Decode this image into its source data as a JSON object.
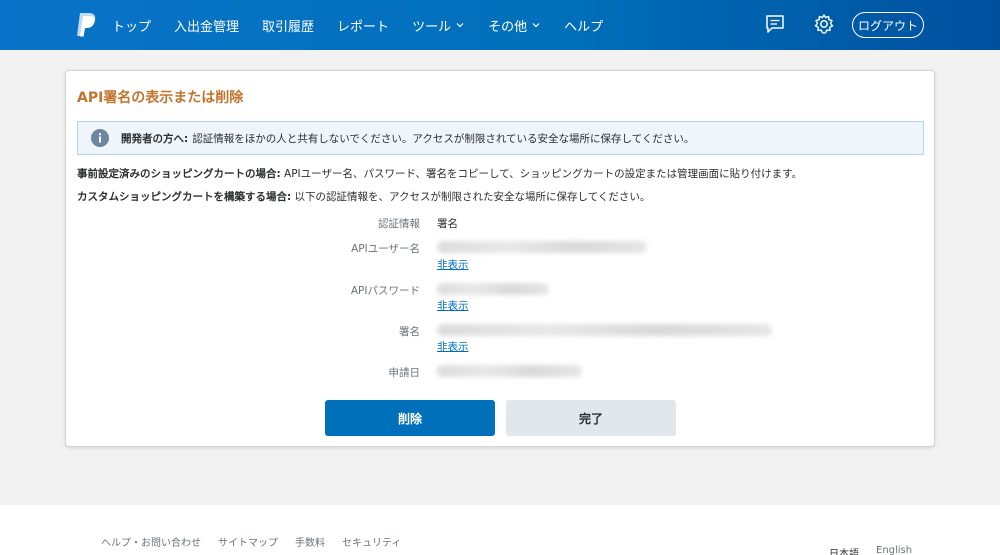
{
  "header": {
    "nav": [
      {
        "label": "トップ",
        "dropdown": false
      },
      {
        "label": "入出金管理",
        "dropdown": false
      },
      {
        "label": "取引履歴",
        "dropdown": false
      },
      {
        "label": "レポート",
        "dropdown": false
      },
      {
        "label": "ツール",
        "dropdown": true
      },
      {
        "label": "その他",
        "dropdown": true
      },
      {
        "label": "ヘルプ",
        "dropdown": false
      }
    ],
    "icons": [
      "message-icon",
      "gear-icon"
    ],
    "logout_label": "ログアウト",
    "colors": {
      "bar": "#0070ba"
    }
  },
  "card": {
    "title": "API署名の表示または削除",
    "notice": {
      "bold": "開発者の方へ:",
      "text": "認証情報をほかの人と共有しないでください。アクセスが制限されている安全な場所に保存してください。"
    },
    "line1": {
      "bold": "事前設定済みのショッピングカートの場合:",
      "text": "APIユーザー名、パスワード、署名をコピーして、ショッピングカートの設定または管理画面に貼り付けます。"
    },
    "line2": {
      "bold": "カスタムショッピングカートを構築する場合:",
      "text": "以下の認証情報を、アクセスが制限された安全な場所に保存してください。"
    },
    "credentials": {
      "label": "認証情報",
      "value": "署名",
      "api_username_label": "APIユーザー名",
      "api_password_label": "APIパスワード",
      "signature_label": "署名",
      "request_date_label": "申請日",
      "hide_label": "非表示"
    },
    "delete_label": "削除",
    "done_label": "完了"
  },
  "footer": {
    "links": [
      "ヘルプ・お問い合わせ",
      "サイトマップ",
      "手数料",
      "セキュリティ"
    ],
    "lang_ja": "日本語",
    "lang_en": "English"
  }
}
